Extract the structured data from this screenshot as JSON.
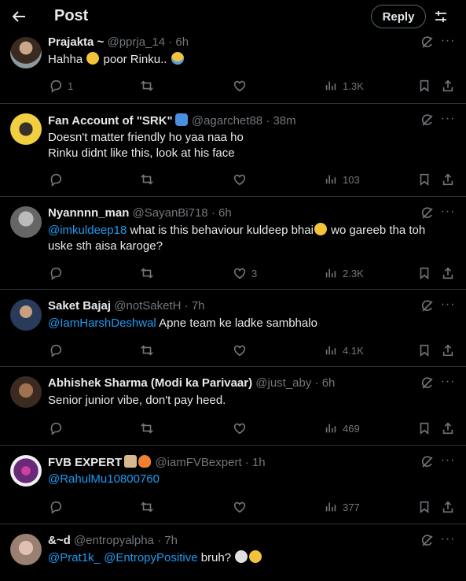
{
  "header": {
    "title": "Post",
    "reply_label": "Reply"
  },
  "tweets": [
    {
      "name": "Prajakta ~",
      "handle": "@pprja_14 · 6h",
      "lines": [
        "Hahha",
        "poor Rinku.."
      ],
      "replies": "1",
      "retweets": "",
      "likes": "",
      "views": "1.3K",
      "avatar_color": "#5a4a3a"
    },
    {
      "name": "Fan Account of \"SRK\"",
      "handle": "@agarchet88 · 38m",
      "lines": [
        "Doesn't matter friendly ho yaa naa ho",
        "Rinku didnt like this, look at his face"
      ],
      "replies": "",
      "retweets": "",
      "likes": "",
      "views": "103",
      "avatar_color": "#e8c830"
    },
    {
      "name": "Nyannnn_man",
      "handle": "@SayanBi718 · 6h",
      "mention": "@imkuldeep18",
      "text": " what is this behaviour kuldeep bhai",
      "text2": " wo gareeb tha toh uske sth aisa karoge?",
      "replies": "",
      "retweets": "",
      "likes": "3",
      "views": "2.3K",
      "avatar_color": "#8a8a8a"
    },
    {
      "name": "Saket Bajaj",
      "handle": "@notSaketH · 7h",
      "mention": "@IamHarshDeshwal",
      "text": " Apne team ke ladke sambhalo",
      "replies": "",
      "retweets": "",
      "likes": "",
      "views": "4.1K",
      "avatar_color": "#3a4a6a"
    },
    {
      "name": "Abhishek Sharma (Modi ka Parivaar)",
      "handle": "@just_aby · 6h",
      "text": "Senior junior vibe, don't pay heed.",
      "replies": "",
      "retweets": "",
      "likes": "",
      "views": "469",
      "avatar_color": "#6a4a3a"
    },
    {
      "name": "FVB EXPERT",
      "handle": "@iamFVBexpert · 1h",
      "mention": "@RahulMu10800760",
      "replies": "",
      "retweets": "",
      "likes": "",
      "views": "377",
      "avatar_color": "#7a2a8a"
    },
    {
      "name": "&~d",
      "handle": "@entropyalpha · 7h",
      "mention": "@Prat1k_",
      "mention2": "@EntropyPositive",
      "text": " bruh?",
      "avatar_color": "#b89a8a"
    }
  ]
}
